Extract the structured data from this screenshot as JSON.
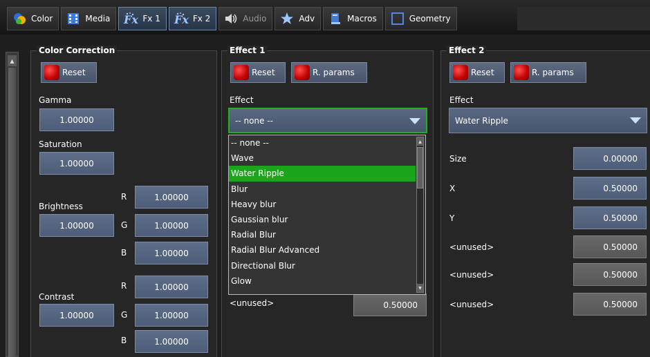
{
  "tabs": [
    {
      "label": "Color",
      "icon": "color-circles-icon",
      "state": "normal"
    },
    {
      "label": "Media",
      "icon": "film-icon",
      "state": "normal"
    },
    {
      "label": "Fx 1",
      "icon": "fx-icon",
      "state": "selected"
    },
    {
      "label": "Fx 2",
      "icon": "fx-icon",
      "state": "selected"
    },
    {
      "label": "Audio",
      "icon": "speaker-icon",
      "state": "disabled"
    },
    {
      "label": "Adv",
      "icon": "star-icon",
      "state": "normal"
    },
    {
      "label": "Macros",
      "icon": "book-icon",
      "state": "normal"
    },
    {
      "label": "Geometry",
      "icon": "frame-icon",
      "state": "normal"
    }
  ],
  "color_correction": {
    "title": "Color Correction",
    "reset_label": "Reset",
    "gamma_label": "Gamma",
    "gamma_value": "1.00000",
    "saturation_label": "Saturation",
    "saturation_value": "1.00000",
    "brightness_label": "Brightness",
    "brightness_value": "1.00000",
    "brightness_r_label": "R",
    "brightness_r": "1.00000",
    "brightness_g_label": "G",
    "brightness_g": "1.00000",
    "brightness_b_label": "B",
    "brightness_b": "1.00000",
    "contrast_label": "Contrast",
    "contrast_value": "1.00000",
    "contrast_r_label": "R",
    "contrast_r": "1.00000",
    "contrast_g_label": "G",
    "contrast_g": "1.00000",
    "contrast_b_label": "B",
    "contrast_b": "1.00000"
  },
  "effect1": {
    "title": "Effect 1",
    "reset_label": "Reset",
    "rparams_label": "R. params",
    "effect_label": "Effect",
    "effect_value": "-- none --",
    "dropdown_items": [
      "-- none --",
      "Wave",
      "Water Ripple",
      "Blur",
      "Heavy blur",
      "Gaussian blur",
      "Radial Blur",
      "Radial Blur Advanced",
      "Directional Blur",
      "Glow"
    ],
    "highlighted_item": "Water Ripple",
    "unused_label": "<unused>",
    "unused_value": "0.50000"
  },
  "effect2": {
    "title": "Effect 2",
    "reset_label": "Reset",
    "rparams_label": "R. params",
    "effect_label": "Effect",
    "effect_value": "Water Ripple",
    "params": [
      {
        "label": "Size",
        "value": "0.00000",
        "enabled": true
      },
      {
        "label": "X",
        "value": "0.50000",
        "enabled": true
      },
      {
        "label": "Y",
        "value": "0.50000",
        "enabled": true
      },
      {
        "label": "<unused>",
        "value": "0.50000",
        "enabled": false
      },
      {
        "label": "<unused>",
        "value": "0.50000",
        "enabled": false
      },
      {
        "label": "<unused>",
        "value": "0.50000",
        "enabled": false
      }
    ]
  },
  "colors": {
    "active_green": "#1aa51a",
    "field_blue": "#5a6882",
    "reset_red": "#e00000"
  }
}
